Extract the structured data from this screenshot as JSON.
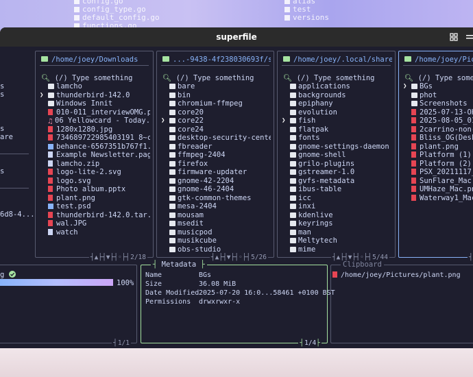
{
  "wallpaper": {
    "col1": [
      "config.go",
      "config_type.go",
      "default_config.go",
      "functions.go"
    ],
    "col2": [
      "alias",
      "test",
      "versions",
      ""
    ]
  },
  "window": {
    "title": "superfile"
  },
  "panels": [
    {
      "path": "/home/joey/Downloads",
      "search_placeholder": "(/) Type something",
      "footer": "2/18",
      "items": [
        {
          "name": "lamcho",
          "type": "folder",
          "cursor": false
        },
        {
          "name": "thunderbird-142.0",
          "type": "folder",
          "cursor": true
        },
        {
          "name": "Windows Innit",
          "type": "folder",
          "cursor": false
        },
        {
          "name": "010-011_interviewOMG.p...",
          "type": "file",
          "cursor": false
        },
        {
          "name": "06 Yellowcard - Today....",
          "type": "music",
          "cursor": false
        },
        {
          "name": "1280x1280.jpg",
          "type": "file",
          "cursor": false
        },
        {
          "name": "734689722985403191 8~c5...",
          "type": "file",
          "cursor": false
        },
        {
          "name": "behance-6567351b767f1...",
          "type": "img",
          "cursor": false
        },
        {
          "name": "Example Newsletter.pag...",
          "type": "doc",
          "cursor": false
        },
        {
          "name": "lamcho.zip",
          "type": "doc",
          "cursor": false
        },
        {
          "name": "logo-lite-2.svg",
          "type": "file",
          "cursor": false
        },
        {
          "name": "logo.svg",
          "type": "file",
          "cursor": false
        },
        {
          "name": "Photo album.pptx",
          "type": "file",
          "cursor": false
        },
        {
          "name": "plant.png",
          "type": "file",
          "cursor": false
        },
        {
          "name": "test.psd",
          "type": "img",
          "cursor": false
        },
        {
          "name": "thunderbird-142.0.tar....",
          "type": "file",
          "cursor": false
        },
        {
          "name": "wal.JPG",
          "type": "file",
          "cursor": false
        },
        {
          "name": "watch",
          "type": "doc",
          "cursor": false
        }
      ]
    },
    {
      "path": "...-9438-4f238030693f/snap",
      "search_placeholder": "(/) Type something",
      "footer": "5/26",
      "items": [
        {
          "name": "bare",
          "type": "folder",
          "cursor": false
        },
        {
          "name": "bin",
          "type": "folder",
          "cursor": false
        },
        {
          "name": "chromium-ffmpeg",
          "type": "folder",
          "cursor": false
        },
        {
          "name": "core20",
          "type": "folder",
          "cursor": false
        },
        {
          "name": "core22",
          "type": "folder",
          "cursor": true
        },
        {
          "name": "core24",
          "type": "folder",
          "cursor": false
        },
        {
          "name": "desktop-security-cente...",
          "type": "folder",
          "cursor": false
        },
        {
          "name": "fbreader",
          "type": "folder",
          "cursor": false
        },
        {
          "name": "ffmpeg-2404",
          "type": "folder",
          "cursor": false
        },
        {
          "name": "firefox",
          "type": "folder",
          "cursor": false
        },
        {
          "name": "firmware-updater",
          "type": "folder",
          "cursor": false
        },
        {
          "name": "gnome-42-2204",
          "type": "folder",
          "cursor": false
        },
        {
          "name": "gnome-46-2404",
          "type": "folder",
          "cursor": false
        },
        {
          "name": "gtk-common-themes",
          "type": "folder",
          "cursor": false
        },
        {
          "name": "mesa-2404",
          "type": "folder",
          "cursor": false
        },
        {
          "name": "mousam",
          "type": "folder",
          "cursor": false
        },
        {
          "name": "msedit",
          "type": "folder",
          "cursor": false
        },
        {
          "name": "musicpod",
          "type": "folder",
          "cursor": false
        },
        {
          "name": "musikcube",
          "type": "folder",
          "cursor": false
        },
        {
          "name": "obs-studio",
          "type": "folder",
          "cursor": false
        }
      ]
    },
    {
      "path": "/home/joey/.local/share",
      "search_placeholder": "(/) Type something",
      "footer": "5/44",
      "items": [
        {
          "name": "applications",
          "type": "folder",
          "cursor": false
        },
        {
          "name": "backgrounds",
          "type": "folder",
          "cursor": false
        },
        {
          "name": "epiphany",
          "type": "folder",
          "cursor": false
        },
        {
          "name": "evolution",
          "type": "folder",
          "cursor": false
        },
        {
          "name": "fish",
          "type": "folder",
          "cursor": true
        },
        {
          "name": "flatpak",
          "type": "folder",
          "cursor": false
        },
        {
          "name": "fonts",
          "type": "folder",
          "cursor": false
        },
        {
          "name": "gnome-settings-daemon",
          "type": "folder",
          "cursor": false
        },
        {
          "name": "gnome-shell",
          "type": "folder",
          "cursor": false
        },
        {
          "name": "grilo-plugins",
          "type": "folder",
          "cursor": false
        },
        {
          "name": "gstreamer-1.0",
          "type": "folder",
          "cursor": false
        },
        {
          "name": "gvfs-metadata",
          "type": "folder",
          "cursor": false
        },
        {
          "name": "ibus-table",
          "type": "folder",
          "cursor": false
        },
        {
          "name": "icc",
          "type": "folder",
          "cursor": false
        },
        {
          "name": "inxi",
          "type": "folder",
          "cursor": false
        },
        {
          "name": "kdenlive",
          "type": "folder",
          "cursor": false
        },
        {
          "name": "keyrings",
          "type": "folder",
          "cursor": false
        },
        {
          "name": "man",
          "type": "folder",
          "cursor": false
        },
        {
          "name": "Meltytech",
          "type": "folder",
          "cursor": false
        },
        {
          "name": "mime",
          "type": "folder",
          "cursor": false
        }
      ]
    },
    {
      "path": "/home/joey/Pictures",
      "search_placeholder": "(/) Type something",
      "footer": "",
      "items": [
        {
          "name": "BGs",
          "type": "folder",
          "cursor": true
        },
        {
          "name": "phot",
          "type": "folder",
          "cursor": false
        },
        {
          "name": "Screenshots",
          "type": "folder",
          "cursor": false
        },
        {
          "name": "2025-07-13-OHR.",
          "type": "file",
          "cursor": false
        },
        {
          "name": "2025-08-05_01-0",
          "type": "file",
          "cursor": false
        },
        {
          "name": "2carrino-non-pl",
          "type": "file",
          "cursor": false
        },
        {
          "name": "Bliss_OG(Deskto",
          "type": "file",
          "cursor": false
        },
        {
          "name": "plant.png",
          "type": "file",
          "cursor": false
        },
        {
          "name": "Platform (1).pn",
          "type": "file",
          "cursor": false
        },
        {
          "name": "Platform (2).pn",
          "type": "file",
          "cursor": false
        },
        {
          "name": "PSX_20211117_16",
          "type": "file",
          "cursor": false
        },
        {
          "name": "SunFlare_Mac.pn",
          "type": "file",
          "cursor": false
        },
        {
          "name": "UMHaze_Mac.png",
          "type": "file",
          "cursor": false
        },
        {
          "name": "Waterway1_Mac.j",
          "type": "file",
          "cursor": false
        }
      ]
    }
  ],
  "left_sidebar": {
    "items": [
      "s",
      "s",
      "s",
      "are",
      "s",
      "6d8-4..."
    ]
  },
  "processes": {
    "label": "g",
    "progress_percent": 100,
    "progress_text": "100%",
    "footer": "1/1"
  },
  "metadata": {
    "title": "Metadata",
    "rows": [
      {
        "key": "Name",
        "value": "BGs"
      },
      {
        "key": "Size",
        "value": "36.08 MiB"
      },
      {
        "key": "Date Modified",
        "value": "2025-07-20 16:0...58461 +0100 BST"
      },
      {
        "key": "Permissions",
        "value": "drwxrwxr-x"
      }
    ],
    "footer": "1/4"
  },
  "clipboard": {
    "title": "Clipboard",
    "items": [
      "/home/joey/Pictures/plant.png"
    ]
  },
  "colors": {
    "background": "#1e1e2e",
    "accent": "#89b4fa",
    "green": "#a6e3a1",
    "file_red": "#e64553"
  }
}
